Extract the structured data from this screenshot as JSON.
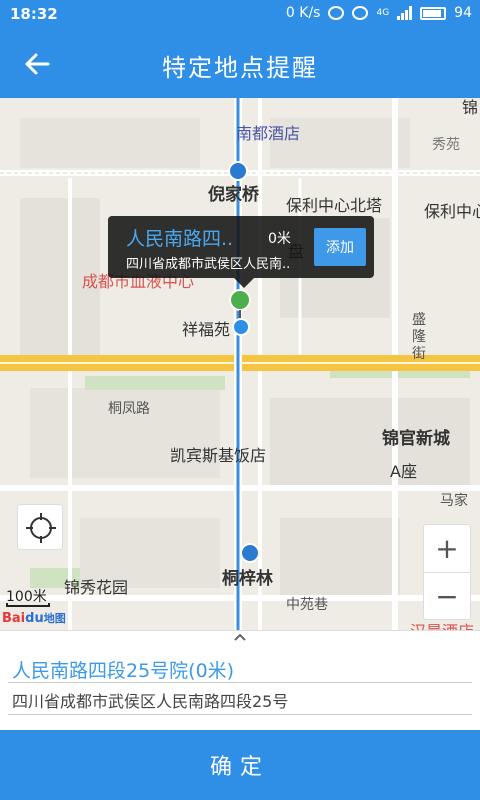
{
  "status_bar": {
    "time": "18:32",
    "net_speed": "0 K/s",
    "network_type": "4G",
    "battery": "94"
  },
  "header": {
    "title": "特定地点提醒",
    "back_icon": "arrow-left-icon"
  },
  "map": {
    "labels": {
      "poi_hotel": "南都酒店",
      "nijiaqiao": "倪家桥",
      "baoli_north": "保利中心北塔",
      "baoli_west": "保利中心西",
      "xiuyuan": "秀苑",
      "jin_top": "锦",
      "pancheng": "盘",
      "blood_center": "成都市血液中心",
      "xiangfuyuan": "祥福苑",
      "shenglongjie": "盛隆街",
      "tongfenglu": "桐凤路",
      "kaibinsi": "凯宾斯基饭店",
      "jinguanxincheng": "锦官新城",
      "a_zuo": "A座",
      "majia": "马家",
      "tongzilin": "桐梓林",
      "jinxiu": "锦秀花园",
      "zhongyuanxiang": "中苑巷",
      "hanxi": "汉晨酒店"
    },
    "scale": "100米",
    "logo": {
      "brand": "Bai",
      "mark": "du",
      "suffix": "地图"
    },
    "zoom_in": "+",
    "zoom_out": "−"
  },
  "popup": {
    "name": "人民南路四..",
    "distance": "0米",
    "address": "四川省成都市武侯区人民南..",
    "add_button": "添加"
  },
  "place": {
    "name": "人民南路四段25号院(0米)",
    "address": "四川省成都市武侯区人民南路四段25号"
  },
  "collapse_icon": "chevron-up-icon",
  "confirm_button": "确定",
  "colors": {
    "primary": "#2f8fe6",
    "road_main": "#f5c542",
    "route": "#3a8ee0"
  }
}
